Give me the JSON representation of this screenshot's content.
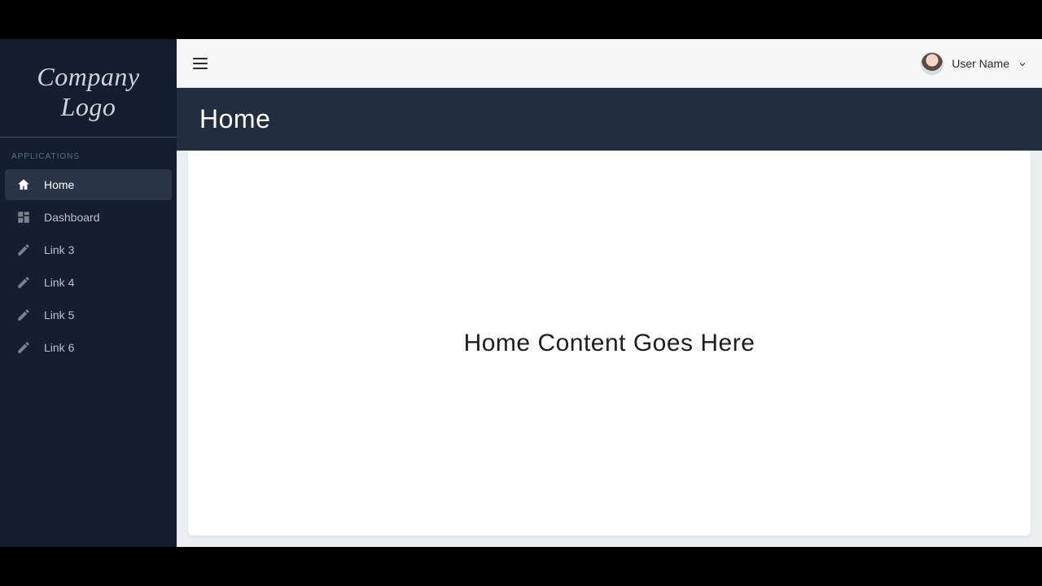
{
  "brand": {
    "logo_text": "Company Logo"
  },
  "sidebar": {
    "section_label": "APPLICATIONS",
    "items": [
      {
        "label": "Home",
        "icon": "home-icon",
        "active": true
      },
      {
        "label": "Dashboard",
        "icon": "dashboard-icon",
        "active": false
      },
      {
        "label": "Link 3",
        "icon": "edit-icon",
        "active": false
      },
      {
        "label": "Link 4",
        "icon": "edit-icon",
        "active": false
      },
      {
        "label": "Link 5",
        "icon": "edit-icon",
        "active": false
      },
      {
        "label": "Link 6",
        "icon": "edit-icon",
        "active": false
      }
    ]
  },
  "topbar": {
    "user_name": "User Name"
  },
  "page": {
    "title": "Home"
  },
  "content": {
    "heading": "Home Content Goes Here"
  },
  "colors": {
    "sidebar_bg": "#141e30",
    "sidebar_active_bg": "#2a3447",
    "page_header_bg": "#222d40",
    "card_bg": "#ffffff",
    "body_bg": "#eceff1"
  }
}
